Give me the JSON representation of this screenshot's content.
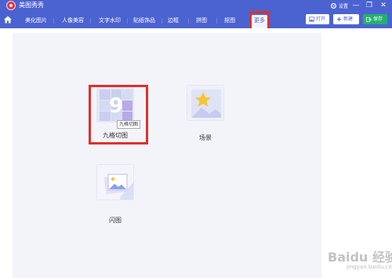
{
  "app": {
    "title": "美图秀秀",
    "settings_label": "设置",
    "minimize": "—",
    "restore": "❐",
    "close": "✕"
  },
  "tabs": [
    {
      "label": "美化图片"
    },
    {
      "label": "人像美容"
    },
    {
      "label": "文字水印"
    },
    {
      "label": "贴纸饰品"
    },
    {
      "label": "边框"
    },
    {
      "label": "拼图"
    },
    {
      "label": "抠图"
    },
    {
      "label": "更多",
      "active": true
    }
  ],
  "toolbar": {
    "open_label": "打开",
    "new_label": "新建",
    "save_label": "保存"
  },
  "features": {
    "nine_grid": {
      "label": "九格切图",
      "badge": "九格切图"
    },
    "scene": {
      "label": "场景"
    },
    "flash": {
      "label": "闪图"
    }
  },
  "watermark": {
    "text": "Baidu 经验",
    "sub": "jingyan.baidu.com"
  },
  "colors": {
    "header": "#4b63d1",
    "highlight": "#e0302b",
    "save": "#21b26d",
    "canvas": "#f3f4fa"
  }
}
